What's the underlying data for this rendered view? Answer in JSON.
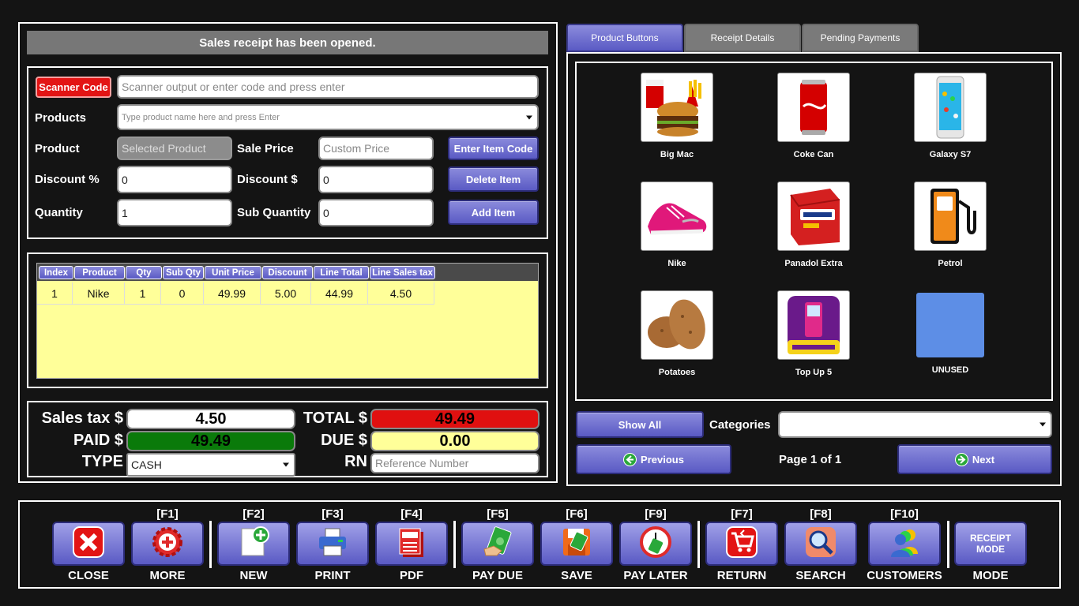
{
  "banner": "Sales receipt has been opened.",
  "entry": {
    "scanner_label": "Scanner Code",
    "scanner_placeholder": "Scanner output or enter code and press enter",
    "products_label": "Products",
    "products_placeholder": "Type product name here and press Enter",
    "product_label": "Product",
    "product_placeholder": "Selected Product",
    "sale_price_label": "Sale Price",
    "sale_price_placeholder": "Custom Price",
    "enter_item_code": "Enter Item Code",
    "discount_pct_label": "Discount %",
    "discount_pct_value": "0",
    "discount_amt_label": "Discount $",
    "discount_amt_value": "0",
    "delete_item": "Delete Item",
    "quantity_label": "Quantity",
    "quantity_value": "1",
    "sub_quantity_label": "Sub Quantity",
    "sub_quantity_value": "0",
    "add_item": "Add Item"
  },
  "grid": {
    "headers": [
      "Index",
      "Product",
      "Qty",
      "Sub Qty",
      "Unit Price",
      "Discount",
      "Line Total",
      "Line Sales tax"
    ],
    "rows": [
      [
        "1",
        "Nike",
        "1",
        "0",
        "49.99",
        "5.00",
        "44.99",
        "4.50"
      ]
    ]
  },
  "totals": {
    "sales_tax_label": "Sales tax $",
    "sales_tax_value": "4.50",
    "total_label": "TOTAL $",
    "total_value": "49.49",
    "paid_label": "PAID $",
    "paid_value": "49.49",
    "due_label": "DUE $",
    "due_value": "0.00",
    "type_label": "TYPE",
    "type_value": "CASH",
    "rn_label": "RN",
    "rn_placeholder": "Reference Number"
  },
  "tabs": [
    "Product Buttons",
    "Receipt Details",
    "Pending Payments"
  ],
  "products": [
    {
      "name": "Big Mac",
      "icon": "burger-icon"
    },
    {
      "name": "Coke Can",
      "icon": "soda-can-icon"
    },
    {
      "name": "Galaxy S7",
      "icon": "phone-icon"
    },
    {
      "name": "Nike",
      "icon": "shoe-icon"
    },
    {
      "name": "Panadol Extra",
      "icon": "medicine-box-icon"
    },
    {
      "name": "Petrol",
      "icon": "fuel-pump-icon"
    },
    {
      "name": "Potatoes",
      "icon": "potato-icon"
    },
    {
      "name": "Top Up 5",
      "icon": "mobile-topup-icon"
    },
    {
      "name": "UNUSED",
      "icon": "blank-tile"
    }
  ],
  "nav": {
    "show_all": "Show All",
    "categories_label": "Categories",
    "categories_value": "",
    "previous": "Previous",
    "page": "Page 1 of 1",
    "next": "Next"
  },
  "toolbar": [
    {
      "key": "",
      "label": "CLOSE",
      "icon": "close-icon"
    },
    {
      "key": "[F1]",
      "label": "MORE",
      "icon": "gear-plus-icon"
    },
    {
      "key": "[F2]",
      "label": "NEW",
      "icon": "new-document-icon"
    },
    {
      "key": "[F3]",
      "label": "PRINT",
      "icon": "printer-icon"
    },
    {
      "key": "[F4]",
      "label": "PDF",
      "icon": "pdf-icon"
    },
    {
      "key": "[F5]",
      "label": "PAY DUE",
      "icon": "cash-hand-icon"
    },
    {
      "key": "[F6]",
      "label": "SAVE",
      "icon": "save-icon"
    },
    {
      "key": "[F9]",
      "label": "PAY LATER",
      "icon": "clock-cash-icon"
    },
    {
      "key": "[F7]",
      "label": "RETURN",
      "icon": "return-cart-icon"
    },
    {
      "key": "[F8]",
      "label": "SEARCH",
      "icon": "search-icon"
    },
    {
      "key": "[F10]",
      "label": "CUSTOMERS",
      "icon": "customers-icon"
    },
    {
      "key": "",
      "label": "MODE",
      "icon": "",
      "button_text": "RECEIPT MODE"
    }
  ],
  "colors": {
    "accent": "#6b6bd0",
    "total": "#e01010",
    "paid": "#0a7a0a",
    "due": "#ffff99",
    "grid_bg": "#ffff99",
    "scanner": "#e31414"
  }
}
